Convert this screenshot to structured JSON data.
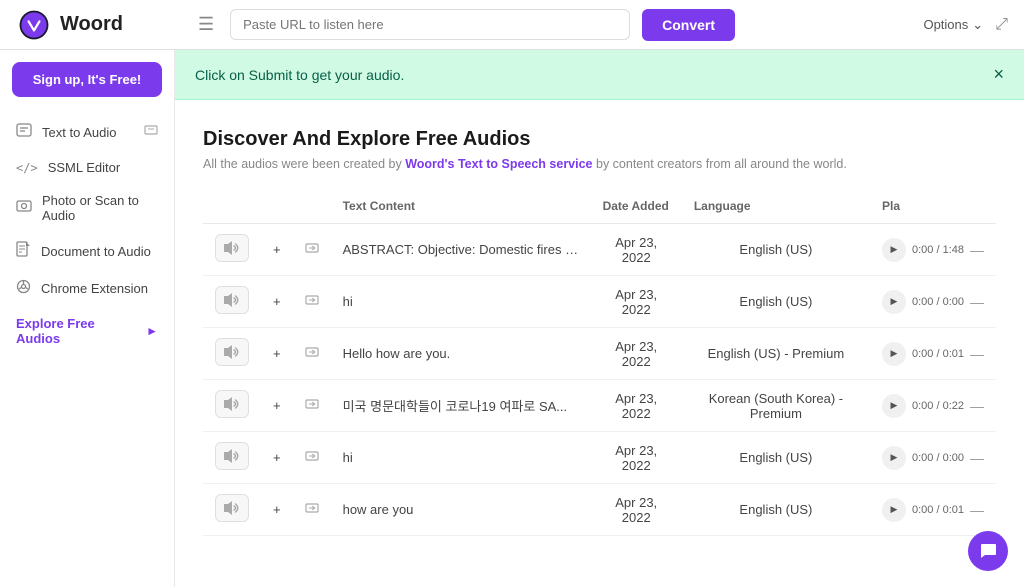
{
  "topbar": {
    "logo_text": "Woord",
    "url_placeholder": "Paste URL to listen here",
    "convert_label": "Convert",
    "options_label": "Options"
  },
  "sidebar": {
    "signup_label": "Sign up, It's Free!",
    "items": [
      {
        "id": "text-to-audio",
        "label": "Text to Audio",
        "icon": "📄",
        "active": false
      },
      {
        "id": "ssml-editor",
        "label": "SSML Editor",
        "icon": "</>",
        "active": false
      },
      {
        "id": "photo-scan",
        "label": "Photo or Scan to Audio",
        "icon": "🖼",
        "active": false
      },
      {
        "id": "document-audio",
        "label": "Document to Audio",
        "icon": "📋",
        "active": false
      },
      {
        "id": "chrome-extension",
        "label": "Chrome Extension",
        "icon": "⚙",
        "active": false
      },
      {
        "id": "explore-free",
        "label": "Explore Free Audios",
        "icon": "",
        "active": true
      }
    ]
  },
  "notice": {
    "text": "Click on Submit to get your audio.",
    "close": "×"
  },
  "main": {
    "title": "Discover And Explore Free Audios",
    "subtitle_pre": "All the audios were been created by ",
    "subtitle_link": "Woord's Text to Speech service",
    "subtitle_post": " by content creators from all around the world.",
    "columns": {
      "text": "Text Content",
      "date": "Date Added",
      "language": "Language",
      "play": "Pla"
    },
    "rows": [
      {
        "text": "ABSTRACT: Objective: Domestic fires and fires in...",
        "date": "Apr 23, 2022",
        "language": "English (US)",
        "current_time": "0:00",
        "total_time": "1:48"
      },
      {
        "text": "hi",
        "date": "Apr 23, 2022",
        "language": "English (US)",
        "current_time": "0:00",
        "total_time": "0:00"
      },
      {
        "text": "Hello how are you.",
        "date": "Apr 23, 2022",
        "language": "English (US) - Premium",
        "current_time": "0:00",
        "total_time": "0:01"
      },
      {
        "text": "미국 명문대학들이 코로나19 여파로 SA...",
        "date": "Apr 23, 2022",
        "language": "Korean (South Korea) - Premium",
        "current_time": "0:00",
        "total_time": "0:22"
      },
      {
        "text": "hi",
        "date": "Apr 23, 2022",
        "language": "English (US)",
        "current_time": "0:00",
        "total_time": "0:00"
      },
      {
        "text": "how are you",
        "date": "Apr 23, 2022",
        "language": "English (US)",
        "current_time": "0:00",
        "total_time": "0:01"
      }
    ]
  }
}
